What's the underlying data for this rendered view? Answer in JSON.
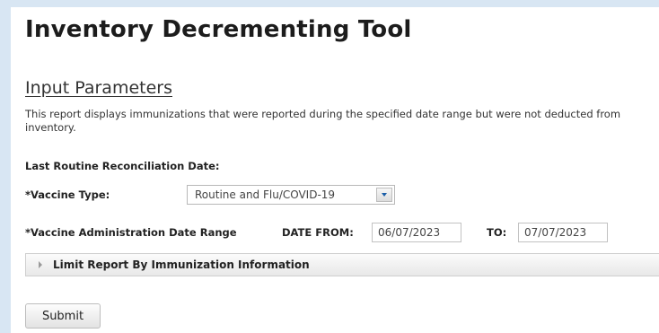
{
  "page": {
    "title": "Inventory Decrementing Tool",
    "section_title": "Input Parameters",
    "description": "This report displays immunizations that were reported during the specified date range but were not deducted from inventory."
  },
  "form": {
    "last_reconciliation_label": "Last Routine Reconciliation Date:",
    "vaccine_type_label": "*Vaccine Type:",
    "vaccine_type_value": "Routine and Flu/COVID-19",
    "date_range_label": "*Vaccine Administration Date Range",
    "date_from_label": "DATE FROM:",
    "date_from_value": "06/07/2023",
    "date_to_label": "TO:",
    "date_to_value": "07/07/2023",
    "accordion_label": "Limit Report By Immunization Information",
    "submit_label": "Submit"
  },
  "icons": {
    "dropdown": "chevron-down-icon",
    "accordion": "triangle-right-icon"
  },
  "colors": {
    "background": "#d8e6f3",
    "panel": "#ffffff",
    "dropdown_arrow": "#1a5ea8"
  }
}
